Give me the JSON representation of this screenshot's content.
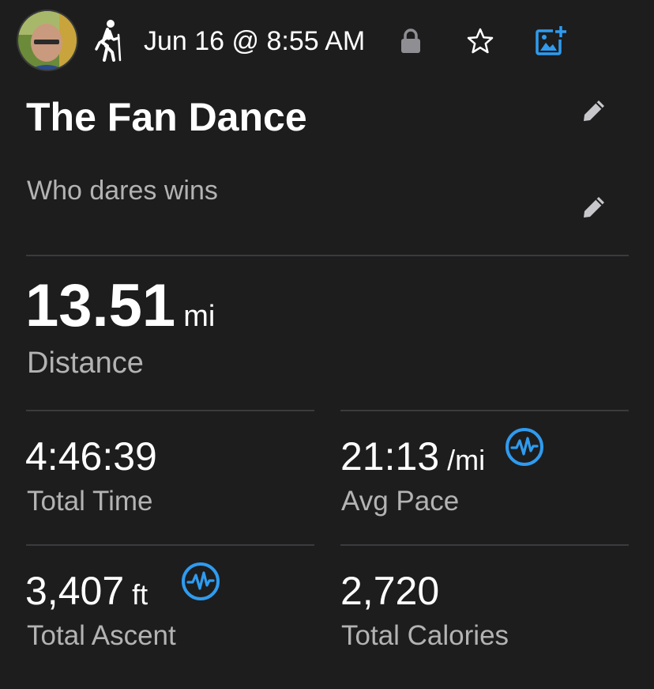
{
  "header": {
    "activity_icon": "hiking-icon",
    "date": "Jun 16 @ 8:55 AM",
    "lock_icon": "lock-icon",
    "favorite_icon": "star-outline-icon",
    "add_photo_icon": "add-photo-icon"
  },
  "activity": {
    "title": "The Fan Dance",
    "description": "Who dares wins"
  },
  "stats": {
    "distance": {
      "value": "13.51",
      "unit": "mi",
      "label": "Distance"
    },
    "total_time": {
      "value": "4:46:39",
      "label": "Total Time"
    },
    "avg_pace": {
      "value": "21:13",
      "unit": "/mi",
      "label": "Avg Pace",
      "badge_icon": "performance-icon"
    },
    "total_ascent": {
      "value": "3,407",
      "unit": "ft",
      "label": "Total Ascent",
      "badge_icon": "performance-icon"
    },
    "total_calories": {
      "value": "2,720",
      "label": "Total Calories"
    }
  },
  "colors": {
    "background": "#1d1d1e",
    "accent": "#2f9bef",
    "secondary_text": "#b3b3b3",
    "divider": "#3b3b3d"
  }
}
